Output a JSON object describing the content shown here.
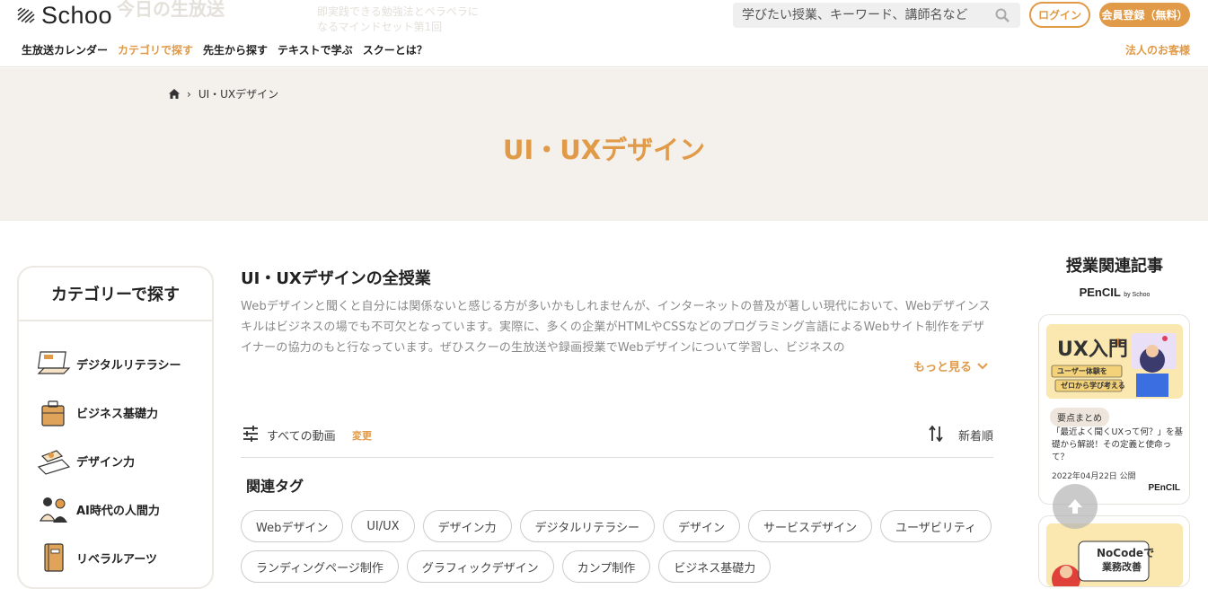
{
  "header": {
    "logo_text": "Schoo",
    "ghost_live": "今日の生放送",
    "ghost_line1": "即実践できる勉強法とペラペラに",
    "ghost_line2": "なるマインドセット第1回",
    "search_placeholder": "学びたい授業、キーワード、講師名など",
    "login_label": "ログイン",
    "signup_label": "会員登録（無料）",
    "nav": [
      "生放送カレンダー",
      "カテゴリで探す",
      "先生から探す",
      "テキストで学ぶ",
      "スクーとは？"
    ],
    "corporate_label": "法人のお客様",
    "accent_color": "#e09a48"
  },
  "hero": {
    "breadcrumb_current": "UI・UXデザイン",
    "title": "UI・UXデザイン"
  },
  "sidebar": {
    "title": "カテゴリーで探す",
    "items": [
      {
        "label": "デジタルリテラシー",
        "icon": "laptop-icon"
      },
      {
        "label": "ビジネス基礎力",
        "icon": "briefcase-icon"
      },
      {
        "label": "デザイン力",
        "icon": "design-tools-icon"
      },
      {
        "label": "AI時代の人間力",
        "icon": "people-icon"
      },
      {
        "label": "リベラルアーツ",
        "icon": "book-icon"
      }
    ]
  },
  "main": {
    "title": "UI・UXデザインの全授業",
    "description": "Webデザインと聞くと自分には関係ないと感じる方が多いかもしれませんが、インターネットの普及が著しい現代において、Webデザインスキルはビジネスの場でも不可欠となっています。実際に、多くの企業がHTMLやCSSなどのプログラミング言語によるWebサイト制作をデザイナーの協力のもと行なっています。ぜひスクーの生放送や録画授業でWebデザインについて学習し、ビジネスの",
    "more_label": "もっと見る",
    "filter_label": "すべての動画",
    "filter_change": "変更",
    "sort_label": "新着順",
    "tags_title": "関連タグ",
    "tags": [
      "Webデザイン",
      "UI/UX",
      "デザイン力",
      "デジタルリテラシー",
      "デザイン",
      "サービスデザイン",
      "ユーザビリティ",
      "ランディングページ制作",
      "グラフィックデザイン",
      "カンプ制作",
      "ビジネス基礎力"
    ]
  },
  "right": {
    "title": "授業関連記事",
    "brand": "PEnCIL",
    "brand_by": "by Schoo",
    "article": {
      "thumb_title": "UX入門",
      "thumb_sub1": "ユーザー体験を",
      "thumb_sub2": "ゼロから学び考える",
      "badge": "要点まとめ",
      "title": "「最近よく聞くUXって何？」を基礎から解説！その定義と使命って？",
      "date": "2022年04月22日 公開",
      "brand": "PEnCIL"
    },
    "article2": {
      "thumb_title1": "NoCodeで",
      "thumb_title2": "業務改善"
    }
  }
}
